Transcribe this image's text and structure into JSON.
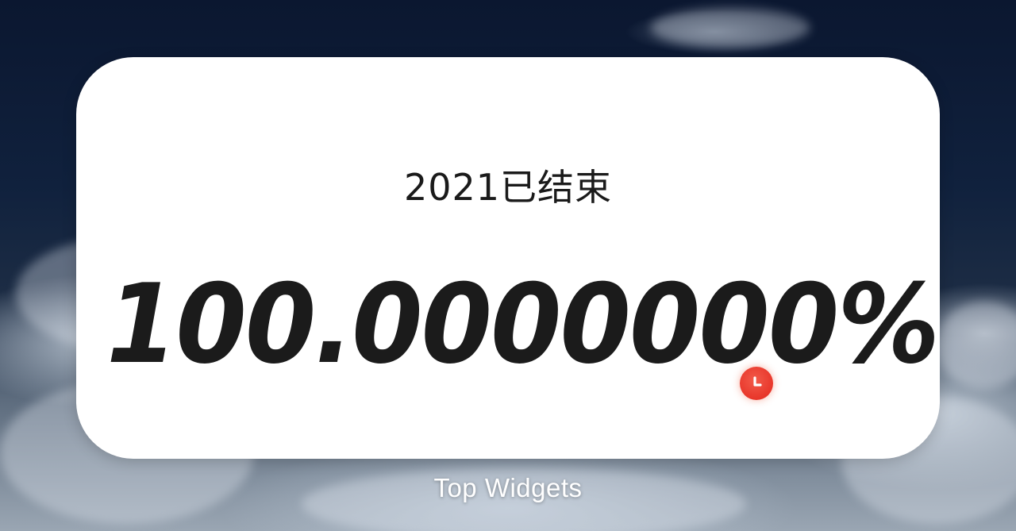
{
  "widget": {
    "title": "2021已结束",
    "percent": "100.0000000%",
    "icon": "clock-icon",
    "icon_color": "#e8362a"
  },
  "home_screen": {
    "widget_label": "Top Widgets"
  },
  "colors": {
    "card_background": "#ffffff",
    "text_primary": "#1b1b1b",
    "label_text": "#ffffff"
  }
}
